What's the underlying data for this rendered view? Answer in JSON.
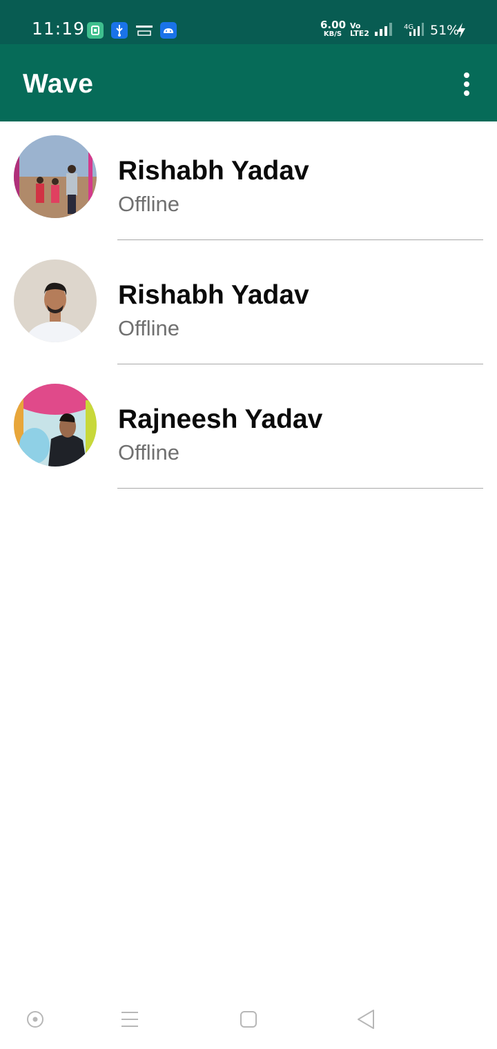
{
  "status_bar": {
    "time": "11:19",
    "net_speed": "6.00",
    "net_speed_unit": "KB/S",
    "volte_top": "Vo",
    "volte_bottom": "LTE2",
    "network_type": "4G",
    "battery": "51%",
    "notification_icons": [
      "app-icon",
      "usb-icon",
      "amazon-icon",
      "android-icon"
    ],
    "colors": {
      "background": "#085c52"
    }
  },
  "app_bar": {
    "title": "Wave",
    "menu_icon": "more-vert-icon",
    "colors": {
      "background": "#066b58"
    }
  },
  "contacts": [
    {
      "name": "Rishabh Yadav",
      "status": "Offline"
    },
    {
      "name": "Rishabh Yadav",
      "status": "Offline"
    },
    {
      "name": "Rajneesh Yadav",
      "status": "Offline"
    }
  ],
  "nav_bar": {
    "buttons": [
      "assistant-circle-icon",
      "menu-lines-icon",
      "home-square-icon",
      "back-triangle-icon"
    ]
  }
}
